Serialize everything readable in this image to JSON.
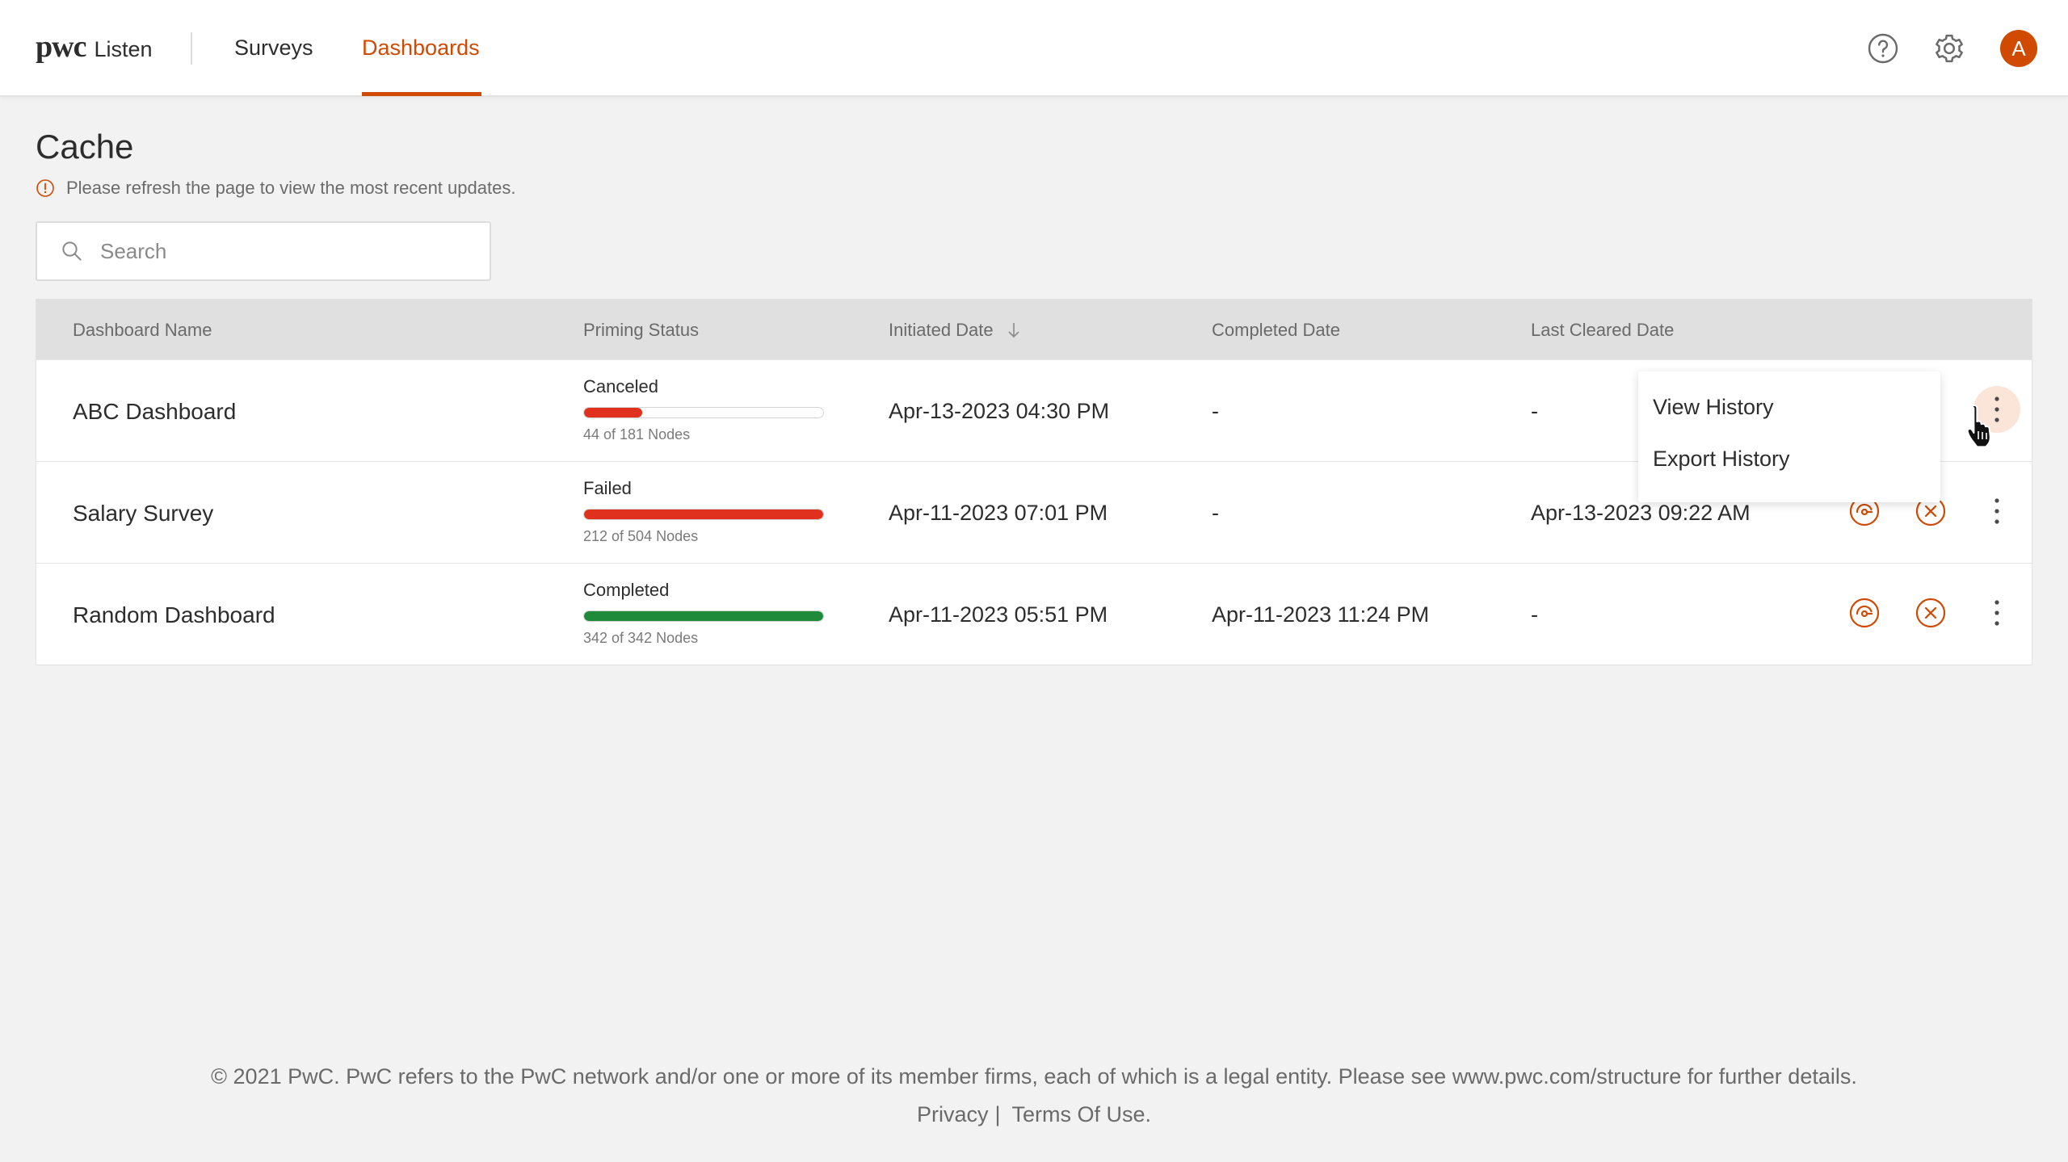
{
  "header": {
    "brand_logo": "pwc",
    "brand_app": "Listen",
    "nav": [
      {
        "label": "Surveys",
        "active": false
      },
      {
        "label": "Dashboards",
        "active": true
      }
    ],
    "help_icon": "question-circle-icon",
    "settings_icon": "gear-icon",
    "avatar_initial": "A"
  },
  "page": {
    "title": "Cache",
    "notice": "Please refresh the page to view the most recent updates.",
    "search_placeholder": "Search",
    "search_value": ""
  },
  "table": {
    "columns": [
      "Dashboard Name",
      "Priming Status",
      "Initiated Date",
      "Completed Date",
      "Last Cleared Date"
    ],
    "sort_column": "Initiated Date",
    "sort_direction": "descending",
    "rows": [
      {
        "name": "ABC Dashboard",
        "status": "Canceled",
        "progress": 0.243,
        "progress_color": "#e0301e",
        "nodes": "44 of 181 Nodes",
        "initiated": "Apr-13-2023  04:30 PM",
        "completed": "-",
        "last_cleared": "-",
        "menu_open": true
      },
      {
        "name": "Salary Survey",
        "status": "Failed",
        "progress": 1.0,
        "progress_color": "#e0301e",
        "nodes": "212 of 504 Nodes",
        "initiated": "Apr-11-2023  07:01 PM",
        "completed": "-",
        "last_cleared": "Apr-13-2023  09:22 AM",
        "menu_open": false
      },
      {
        "name": "Random Dashboard",
        "status": "Completed",
        "progress": 1.0,
        "progress_color": "#1f8a3a",
        "nodes": "342 of 342 Nodes",
        "initiated": "Apr-11-2023  05:51 PM",
        "completed": "Apr-11-2023  11:24 PM",
        "last_cleared": "-",
        "menu_open": false
      }
    ]
  },
  "menu": {
    "items": [
      "View History",
      "Export History"
    ]
  },
  "colors": {
    "accent": "#d04a02",
    "danger": "#e0301e",
    "success": "#1f8a3a"
  },
  "footer": {
    "text": "© 2021 PwC. PwC refers to the PwC network and/or one or more of its member firms, each of which is a legal entity. Please see www.pwc.com/structure for further details.",
    "privacy": "Privacy",
    "separator": "|",
    "terms": "Terms Of Use."
  }
}
